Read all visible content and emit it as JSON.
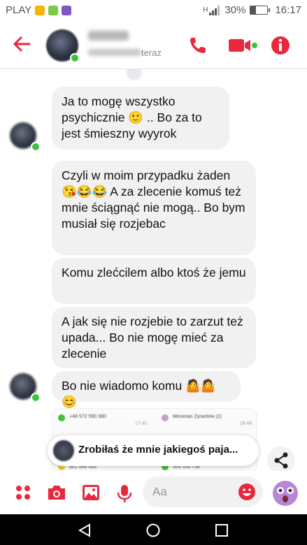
{
  "status_bar": {
    "carrier": "PLAY",
    "signal": "H",
    "battery": "30%",
    "time": "16:17",
    "app_icon_colors": [
      "#f4b400",
      "#7ec84a",
      "#7e57c2"
    ]
  },
  "header": {
    "status_suffix": "teraz",
    "accent": "#e8283c",
    "icons": [
      "back-arrow-icon",
      "phone-icon",
      "video-icon",
      "info-icon"
    ]
  },
  "messages": [
    {
      "text": "Ja to mogę wszystko psychicznie 🙂 ..  Bo za to jest  śmieszny wyyrok"
    },
    {
      "text": "Czyli w moim przypadku żaden 😘😂😂 A za zlecenie komuś też mnie ściągnąć nie mogą.. Bo bym musiał się rozjebac"
    },
    {
      "text": "Komu zlećcilem  albo ktoś że jemu"
    },
    {
      "text": "A jak się nie rozjebie  to zarzut też upada...  Bo nie mogę mieć za zlecenie"
    },
    {
      "text": "Bo nie wiadomo  komu 🤷🤷😊"
    }
  ],
  "shared_screenshot": {
    "rows": [
      {
        "name": "+48 572 590 380",
        "time": "17:40",
        "color": "#3ec23e"
      },
      {
        "name": "Mecenas Zyrardów (2)",
        "time": "18:44",
        "color": "#c9a0c9"
      },
      {
        "name": "881 064 493",
        "color": "#f4c430"
      },
      {
        "name": "509 533 736",
        "color": "#3ec23e"
      }
    ]
  },
  "notice": {
    "text": "Zrobiłaś że mnie jakiegoś paja..."
  },
  "composer": {
    "placeholder": "Aa"
  }
}
